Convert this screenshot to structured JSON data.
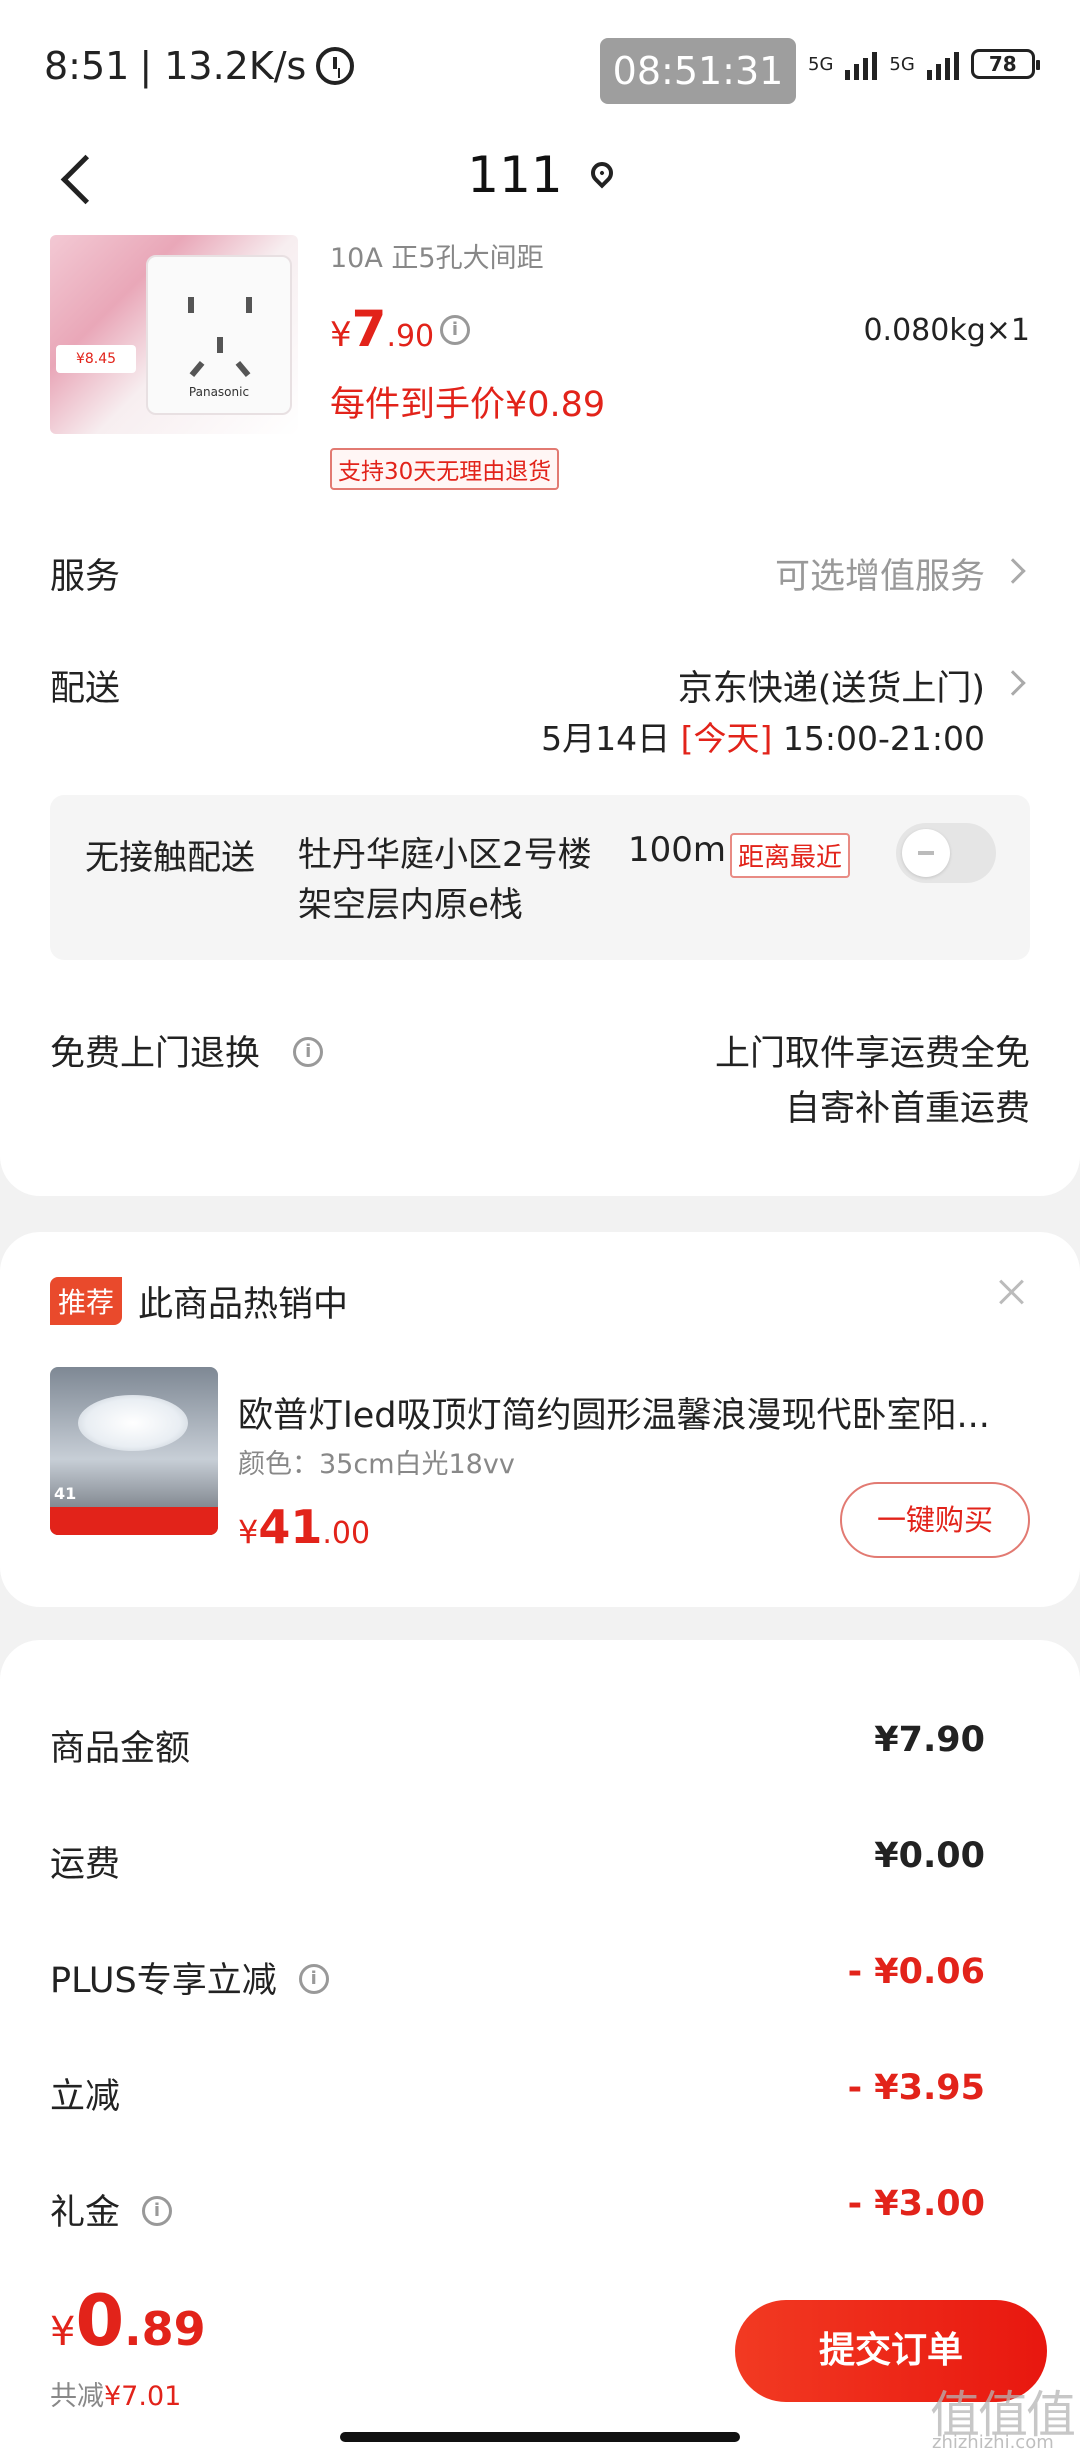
{
  "status_bar": {
    "time": "8:51",
    "speed": "| 13.2K/s",
    "clock_pill": "08:51:31",
    "network_1": "5G",
    "network_2": "5G",
    "battery": "78"
  },
  "header": {
    "title": "111"
  },
  "product": {
    "spec": "10A 正5孔大间距",
    "price_symbol": "¥",
    "price_int": "7",
    "price_dec": ".90",
    "weight_qty": "0.080kg×1",
    "unit_price": "每件到手价¥0.89",
    "return_badge": "支持30天无理由退货",
    "image_tag": "¥8.45",
    "image_brand": "Panasonic"
  },
  "service": {
    "label": "服务",
    "value": "可选增值服务"
  },
  "delivery": {
    "label": "配送",
    "method": "京东快递(送货上门)",
    "date": "5月14日",
    "today": "[今天]",
    "time_window": "15:00-21:00"
  },
  "contactless": {
    "label": "无接触配送",
    "address": "牡丹华庭小区2号楼",
    "address_line2": "架空层内原e栈",
    "distance": "100m",
    "badge": "距离最近"
  },
  "free_return": {
    "label": "免费上门退换",
    "line1": "上门取件享运费全免",
    "line2": "自寄补首重运费"
  },
  "recommend": {
    "badge": "推荐",
    "title": "此商品热销中",
    "product_name": "欧普灯led吸顶灯简约圆形温馨浪漫现代卧室阳...",
    "spec": "颜色：35cm白光18vv",
    "price_symbol": "¥",
    "price_int": "41",
    "price_dec": ".00",
    "buy_button": "一键购买",
    "image_tag": "41"
  },
  "fees": [
    {
      "label": "商品金额",
      "value": "¥7.90",
      "discount": false,
      "info": false
    },
    {
      "label": "运费",
      "value": "¥0.00",
      "discount": false,
      "info": false
    },
    {
      "label": "PLUS专享立减",
      "value": "- ¥0.06",
      "discount": true,
      "info": true
    },
    {
      "label": "立减",
      "value": "- ¥3.95",
      "discount": true,
      "info": false
    },
    {
      "label": "礼金",
      "value": "- ¥3.00",
      "discount": true,
      "info": true
    }
  ],
  "footer": {
    "total_symbol": "¥",
    "total_int": "0",
    "total_dec": ".89",
    "saved_label": "共减",
    "saved_amount": "¥7.01",
    "submit": "提交订单"
  },
  "watermark": {
    "text": "值值值",
    "sub": "zhizhizhi.com"
  },
  "colors": {
    "accent": "#e2231a",
    "background": "#f2f2f2"
  }
}
